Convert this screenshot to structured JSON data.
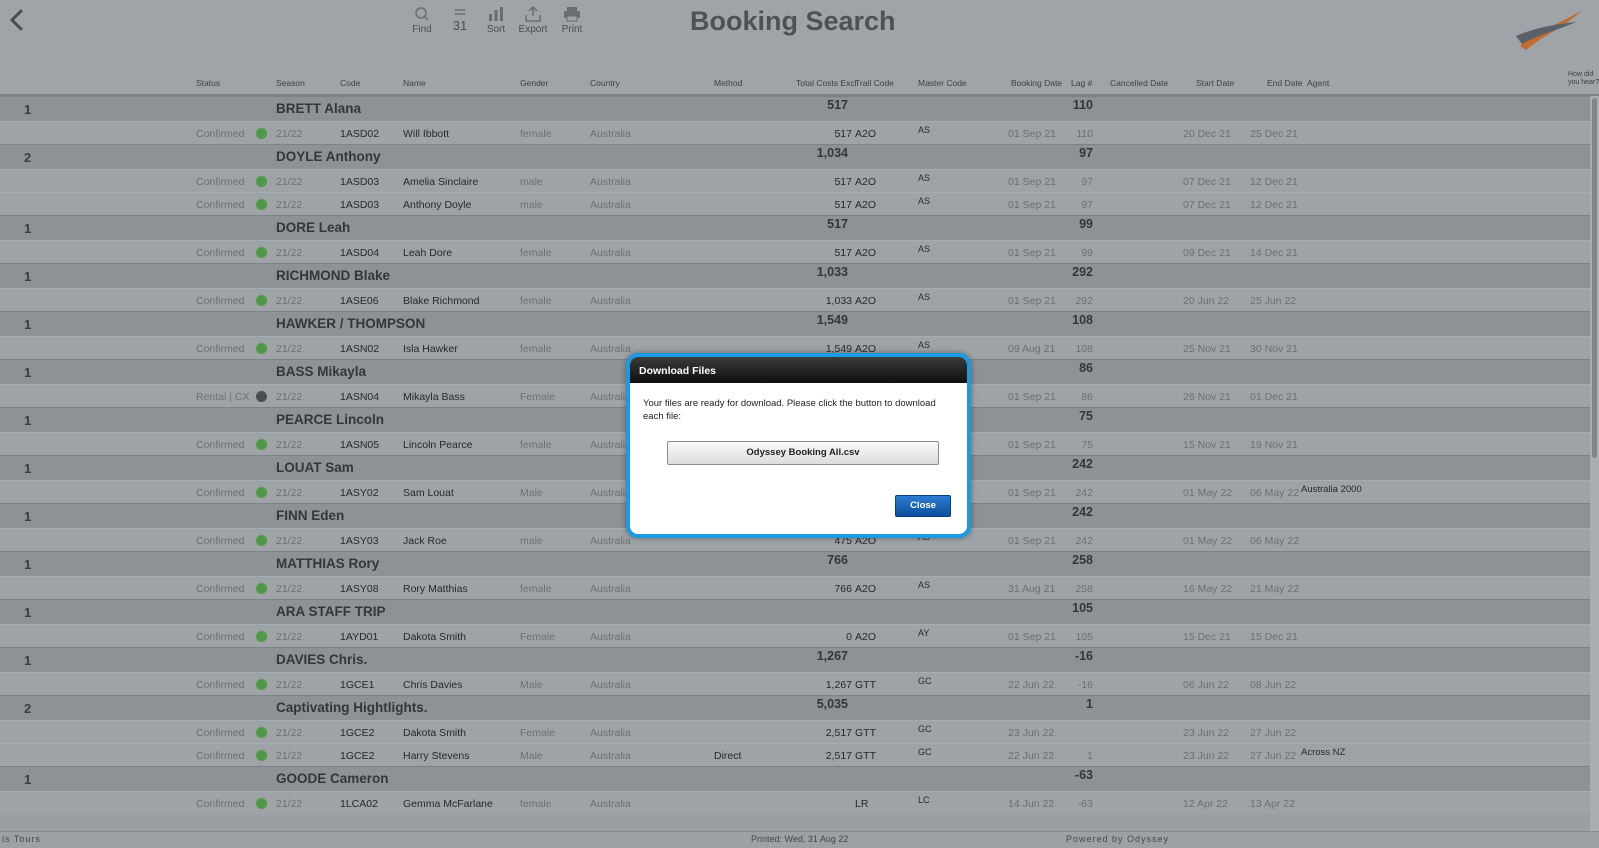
{
  "header": {
    "title": "Booking Search",
    "tools": [
      {
        "label": "Find",
        "icon": "search-icon"
      },
      {
        "label": "31",
        "icon": "records-icon"
      },
      {
        "label": "Sort",
        "icon": "sort-icon"
      },
      {
        "label": "Export",
        "icon": "export-icon"
      },
      {
        "label": "Print",
        "icon": "print-icon"
      }
    ],
    "how_did_line1": "How did",
    "how_did_line2": "you hear?"
  },
  "columns": [
    "Status",
    "Season",
    "Code",
    "Name",
    "Gender",
    "Country",
    "Method",
    "Total Costs Excl",
    "Trail Code",
    "Master Code",
    "Booking Date",
    "Lag #",
    "Cancelled Date",
    "Start Date",
    "End Date",
    "Agent"
  ],
  "groups": [
    {
      "count": "1",
      "name": "BRETT Alana",
      "cost": "517",
      "lag": "110",
      "rows": [
        {
          "status": "Confirmed",
          "dot": "green",
          "season": "21/22",
          "code": "1ASD02",
          "name": "Will Ibbott",
          "gender": "female",
          "country": "Australia",
          "method": "",
          "cost": "517",
          "trail": "A2O",
          "master": "AS",
          "booking": "01 Sep 21",
          "lag": "110",
          "start": "20 Dec 21",
          "end": "25 Dec 21",
          "agent": ""
        }
      ]
    },
    {
      "count": "2",
      "name": "DOYLE Anthony",
      "cost": "1,034",
      "lag": "97",
      "rows": [
        {
          "status": "Confirmed",
          "dot": "green",
          "season": "21/22",
          "code": "1ASD03",
          "name": "Amelia Sinclaire",
          "gender": "male",
          "country": "Australia",
          "method": "",
          "cost": "517",
          "trail": "A2O",
          "master": "AS",
          "booking": "01 Sep 21",
          "lag": "97",
          "start": "07 Dec 21",
          "end": "12 Dec 21",
          "agent": ""
        },
        {
          "status": "Confirmed",
          "dot": "green",
          "season": "21/22",
          "code": "1ASD03",
          "name": "Anthony Doyle",
          "gender": "male",
          "country": "Australia",
          "method": "",
          "cost": "517",
          "trail": "A2O",
          "master": "AS",
          "booking": "01 Sep 21",
          "lag": "97",
          "start": "07 Dec 21",
          "end": "12 Dec 21",
          "agent": ""
        }
      ]
    },
    {
      "count": "1",
      "name": "DORE Leah",
      "cost": "517",
      "lag": "99",
      "rows": [
        {
          "status": "Confirmed",
          "dot": "green",
          "season": "21/22",
          "code": "1ASD04",
          "name": "Leah Dore",
          "gender": "female",
          "country": "Australia",
          "method": "",
          "cost": "517",
          "trail": "A2O",
          "master": "AS",
          "booking": "01 Sep 21",
          "lag": "99",
          "start": "09 Dec 21",
          "end": "14 Dec 21",
          "agent": ""
        }
      ]
    },
    {
      "count": "1",
      "name": "RICHMOND Blake",
      "cost": "1,033",
      "lag": "292",
      "rows": [
        {
          "status": "Confirmed",
          "dot": "green",
          "season": "21/22",
          "code": "1ASE06",
          "name": "Blake Richmond",
          "gender": "female",
          "country": "Australia",
          "method": "",
          "cost": "1,033",
          "trail": "A2O",
          "master": "AS",
          "booking": "01 Sep 21",
          "lag": "292",
          "start": "20 Jun 22",
          "end": "25 Jun 22",
          "agent": ""
        }
      ]
    },
    {
      "count": "1",
      "name": "HAWKER / THOMPSON",
      "cost": "1,549",
      "lag": "108",
      "rows": [
        {
          "status": "Confirmed",
          "dot": "green",
          "season": "21/22",
          "code": "1ASN02",
          "name": "Isla Hawker",
          "gender": "female",
          "country": "Australia",
          "method": "",
          "cost": "1,549",
          "trail": "A2O",
          "master": "AS",
          "booking": "09 Aug 21",
          "lag": "108",
          "start": "25 Nov 21",
          "end": "30 Nov 21",
          "agent": ""
        }
      ]
    },
    {
      "count": "1",
      "name": "BASS Mikayla",
      "cost": "",
      "lag": "86",
      "rows": [
        {
          "status": "Rental | CX",
          "dot": "cx",
          "season": "21/22",
          "code": "1ASN04",
          "name": "Mikayla Bass",
          "gender": "Female",
          "country": "Australia",
          "method": "",
          "cost": "",
          "trail": "",
          "master": "",
          "booking": "01 Sep 21",
          "lag": "86",
          "start": "26 Nov 21",
          "end": "01 Dec 21",
          "agent": ""
        }
      ]
    },
    {
      "count": "1",
      "name": "PEARCE Lincoln",
      "cost": "",
      "lag": "75",
      "rows": [
        {
          "status": "Confirmed",
          "dot": "green",
          "season": "21/22",
          "code": "1ASN05",
          "name": "Lincoln Pearce",
          "gender": "female",
          "country": "Australia",
          "method": "",
          "cost": "",
          "trail": "",
          "master": "",
          "booking": "01 Sep 21",
          "lag": "75",
          "start": "15 Nov 21",
          "end": "19 Nov 21",
          "agent": ""
        }
      ]
    },
    {
      "count": "1",
      "name": "LOUAT Sam",
      "cost": "",
      "lag": "242",
      "rows": [
        {
          "status": "Confirmed",
          "dot": "green",
          "season": "21/22",
          "code": "1ASY02",
          "name": "Sam Louat",
          "gender": "Male",
          "country": "Australia",
          "method": "",
          "cost": "",
          "trail": "",
          "master": "",
          "booking": "01 Sep 21",
          "lag": "242",
          "start": "01 May 22",
          "end": "06 May 22",
          "agent": "Australia 2000"
        }
      ]
    },
    {
      "count": "1",
      "name": "FINN Eden",
      "cost": "",
      "lag": "242",
      "rows": [
        {
          "status": "Confirmed",
          "dot": "green",
          "season": "21/22",
          "code": "1ASY03",
          "name": "Jack Roe",
          "gender": "male",
          "country": "Australia",
          "method": "",
          "cost": "475",
          "trail": "A2O",
          "master": "AS",
          "booking": "01 Sep 21",
          "lag": "242",
          "start": "01 May 22",
          "end": "06 May 22",
          "agent": ""
        }
      ]
    },
    {
      "count": "1",
      "name": "MATTHIAS Rory",
      "cost": "766",
      "lag": "258",
      "rows": [
        {
          "status": "Confirmed",
          "dot": "green",
          "season": "21/22",
          "code": "1ASY08",
          "name": "Rory Matthias",
          "gender": "female",
          "country": "Australia",
          "method": "",
          "cost": "766",
          "trail": "A2O",
          "master": "AS",
          "booking": "31 Aug 21",
          "lag": "258",
          "start": "16 May 22",
          "end": "21 May 22",
          "agent": ""
        }
      ]
    },
    {
      "count": "1",
      "name": "ARA STAFF TRIP",
      "cost": "",
      "lag": "105",
      "rows": [
        {
          "status": "Confirmed",
          "dot": "green",
          "season": "21/22",
          "code": "1AYD01",
          "name": "Dakota Smith",
          "gender": "Female",
          "country": "Australia",
          "method": "",
          "cost": "0",
          "trail": "A2O",
          "master": "AY",
          "booking": "01 Sep 21",
          "lag": "105",
          "start": "15 Dec 21",
          "end": "15 Dec 21",
          "agent": ""
        }
      ]
    },
    {
      "count": "1",
      "name": "DAVIES Chris.",
      "cost": "1,267",
      "lag": "-16",
      "rows": [
        {
          "status": "Confirmed",
          "dot": "green",
          "season": "21/22",
          "code": "1GCE1",
          "name": "Chris Davies",
          "gender": "Male",
          "country": "Australia",
          "method": "",
          "cost": "1,267",
          "trail": "GTT",
          "master": "GC",
          "booking": "22 Jun 22",
          "lag": "-16",
          "start": "06 Jun 22",
          "end": "08 Jun 22",
          "agent": ""
        }
      ]
    },
    {
      "count": "2",
      "name": "Captivating Hightlights.",
      "cost": "5,035",
      "lag": "1",
      "rows": [
        {
          "status": "Confirmed",
          "dot": "green",
          "season": "21/22",
          "code": "1GCE2",
          "name": "Dakota Smith",
          "gender": "Female",
          "country": "Australia",
          "method": "",
          "cost": "2,517",
          "trail": "GTT",
          "master": "GC",
          "booking": "23 Jun 22",
          "lag": "",
          "start": "23 Jun 22",
          "end": "27 Jun 22",
          "agent": ""
        },
        {
          "status": "Confirmed",
          "dot": "green",
          "season": "21/22",
          "code": "1GCE2",
          "name": "Harry Stevens",
          "gender": "Male",
          "country": "Australia",
          "method": "Direct",
          "cost": "2,517",
          "trail": "GTT",
          "master": "GC",
          "booking": "22 Jun 22",
          "lag": "1",
          "start": "23 Jun 22",
          "end": "27 Jun 22",
          "agent": "Across NZ"
        }
      ]
    },
    {
      "count": "1",
      "name": "GOODE Cameron",
      "cost": "",
      "lag": "-63",
      "rows": [
        {
          "status": "Confirmed",
          "dot": "green",
          "season": "21/22",
          "code": "1LCA02",
          "name": "Gemma McFarlane",
          "gender": "female",
          "country": "Australia",
          "method": "",
          "cost": "",
          "trail": "LR",
          "master": "LC",
          "booking": "14 Jun 22",
          "lag": "-63",
          "start": "12 Apr 22",
          "end": "13 Apr 22",
          "agent": ""
        }
      ]
    }
  ],
  "footer": {
    "left": "ls Tours",
    "center": "Printed: Wed, 31 Aug 22",
    "right": "Powered by Odyssey"
  },
  "modal": {
    "title": "Download Files",
    "message": "Your files are ready for download. Please click the button to download each file:",
    "file_button": "Odyssey Booking All.csv",
    "close_button": "Close"
  },
  "colors": {
    "accent": "#1a9ae0",
    "status_dot": "#4f9a47",
    "close_button": "#1a63b8"
  }
}
